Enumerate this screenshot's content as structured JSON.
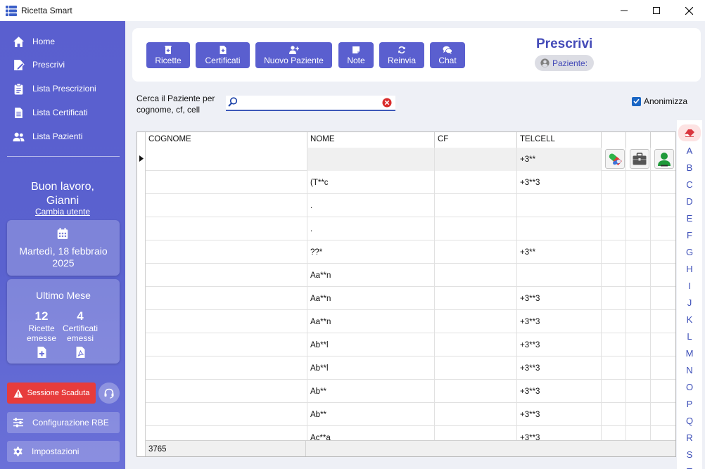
{
  "window": {
    "title": "Ricetta Smart"
  },
  "sidebar": {
    "nav": [
      {
        "label": "Home",
        "icon": "home-icon"
      },
      {
        "label": "Prescrivi",
        "icon": "prescribe-icon"
      },
      {
        "label": "Lista Prescrizioni",
        "icon": "clipboard-icon"
      },
      {
        "label": "Lista Certificati",
        "icon": "certificate-icon"
      },
      {
        "label": "Lista Pazienti",
        "icon": "users-icon"
      }
    ],
    "greeting_line1": "Buon lavoro,",
    "greeting_line2": "Gianni",
    "change_user": "Cambia utente",
    "date_line1": "Martedì, 18 febbraio",
    "date_line2": "2025",
    "stats": {
      "title": "Ultimo Mese",
      "ricette_count": "12",
      "ricette_label1": "Ricette",
      "ricette_label2": "emesse",
      "certificati_count": "4",
      "certificati_label1": "Certificati",
      "certificati_label2": "emessi"
    },
    "session_label": "Sessione Scaduta",
    "config_label": "Configurazione RBE",
    "settings_label": "Impostazioni"
  },
  "toolbar": {
    "buttons": [
      {
        "label": "Ricette",
        "icon": "prescription-icon"
      },
      {
        "label": "Certificati",
        "icon": "certificate-add-icon"
      },
      {
        "label": "Nuovo Paziente",
        "icon": "add-user-icon"
      },
      {
        "label": "Note",
        "icon": "note-icon"
      },
      {
        "label": "Reinvia",
        "icon": "refresh-icon"
      },
      {
        "label": "Chat",
        "icon": "chat-icon"
      }
    ],
    "page_title": "Prescrivi",
    "patient_label": "Paziente:"
  },
  "search": {
    "label": "Cerca il Paziente per cognome, cf, cell",
    "value": "",
    "anonimizza_label": "Anonimizza",
    "anonimizza_checked": true
  },
  "grid": {
    "columns": [
      "COGNOME",
      "NOME",
      "CF",
      "TELCELL"
    ],
    "rows": [
      {
        "cognome": "",
        "nome": "",
        "cf": "",
        "tel": "+3**"
      },
      {
        "cognome": "",
        "nome": "(T**c",
        "cf": "",
        "tel": "+3**3"
      },
      {
        "cognome": "",
        "nome": ".",
        "cf": "",
        "tel": ""
      },
      {
        "cognome": "",
        "nome": ".",
        "cf": "",
        "tel": ""
      },
      {
        "cognome": "",
        "nome": "??*",
        "cf": "",
        "tel": "+3**"
      },
      {
        "cognome": "",
        "nome": "Aa**n",
        "cf": "",
        "tel": ""
      },
      {
        "cognome": "",
        "nome": "Aa**n",
        "cf": "",
        "tel": "+3**3"
      },
      {
        "cognome": "",
        "nome": "Aa**n",
        "cf": "",
        "tel": "+3**3"
      },
      {
        "cognome": "",
        "nome": "Ab**l",
        "cf": "",
        "tel": "+3**3"
      },
      {
        "cognome": "",
        "nome": "Ab**l",
        "cf": "",
        "tel": "+3**3"
      },
      {
        "cognome": "",
        "nome": "Ab**",
        "cf": "",
        "tel": "+3**3"
      },
      {
        "cognome": "",
        "nome": "Ab**",
        "cf": "",
        "tel": "+3**3"
      },
      {
        "cognome": "",
        "nome": "Ac**a",
        "cf": "",
        "tel": "+3**3"
      }
    ],
    "total_count": "3765"
  },
  "alphabet": [
    "A",
    "B",
    "C",
    "D",
    "E",
    "F",
    "G",
    "H",
    "I",
    "J",
    "K",
    "L",
    "M",
    "N",
    "O",
    "P",
    "Q",
    "R",
    "S",
    "T"
  ],
  "colors": {
    "accent": "#5a5fcf",
    "title": "#444bb8",
    "danger": "#e73c3c"
  }
}
